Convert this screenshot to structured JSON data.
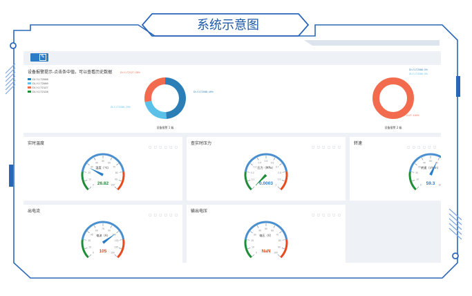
{
  "header": {
    "title": "系统示意图"
  },
  "colors": {
    "frame": "#2a66b8",
    "accent": "#1d5aa8",
    "teal": "#2b7fb6",
    "orange": "#f26b4f",
    "light_blue": "#5cc1e8",
    "green": "#1f8c36"
  },
  "overview": {
    "title": "设备报警提示-点击条中值，可以查看历史数据",
    "legend": [
      {
        "label": "DI-YJ-T2088",
        "color": "#2b7fb6"
      },
      {
        "label": "DI-YJ-T2089",
        "color": "#5cc1e8"
      },
      {
        "label": "DI-YJ-T2127",
        "color": "#f26b4f"
      },
      {
        "label": "DI-YJ-T2128",
        "color": "#1f8c36"
      }
    ]
  },
  "chart_data": [
    {
      "type": "pie",
      "title": "",
      "categories": [
        "DI-YJ-T2088",
        "DI-YJ-T2089",
        "DI-YJ-T2127"
      ],
      "values": [
        49,
        23,
        28
      ],
      "labels": [
        "DI-YJ-T2088: 49%",
        "DI-YJ-T2089: 23%",
        "DI-YJ-T2127: 28%"
      ],
      "caption": "设备报警 1 级"
    },
    {
      "type": "pie",
      "title": "",
      "categories": [
        "DI-YJ-T2088",
        "DI-YJ-T2089",
        "DI-YJ-T2127"
      ],
      "values": [
        0,
        0,
        100
      ],
      "labels": [
        "DI-YJ-T2088: 0%",
        "DI-YJ-T2089: 0%",
        "DI-YJ-T2127: 100%"
      ],
      "caption": "设备报警 2 级"
    }
  ],
  "gauges": [
    {
      "title": "实时温度",
      "unit_label": "温度（℃）",
      "value": 26.82,
      "display": "26.82",
      "min": 0,
      "max": 100,
      "value_color": "#1f8c36"
    },
    {
      "title": "查实时压力",
      "unit_label": "压力（MPa）",
      "value": 0.0003,
      "display": "0.0003",
      "min": 0,
      "max": 1,
      "value_color": "#2a7cc7"
    },
    {
      "title": "转速",
      "unit_label": "转速（r/min）",
      "value": 59.3,
      "display": "59.3",
      "min": 0,
      "max": 100,
      "value_color": "#2a7cc7"
    },
    {
      "title": "出电流",
      "unit_label": "电流（A）",
      "value": 105,
      "display": "105",
      "min": 0,
      "max": 150,
      "value_color": "#e8491d"
    },
    {
      "title": "输出电压",
      "unit_label": "电压（V）",
      "value": null,
      "display": "NaN",
      "min": 0,
      "max": 100,
      "value_color": "#e8491d"
    }
  ]
}
